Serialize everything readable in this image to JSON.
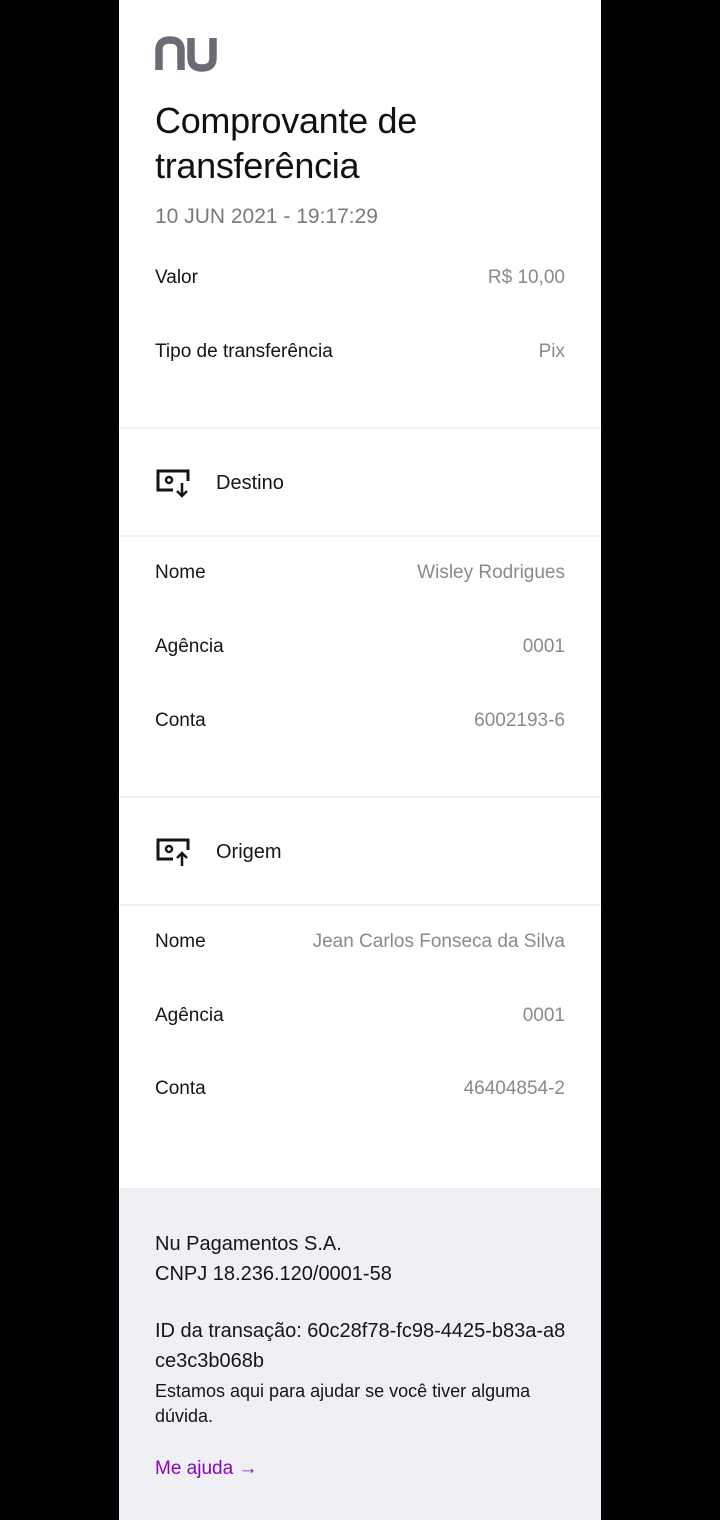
{
  "brand": {
    "logo_text": "nu"
  },
  "header": {
    "title": "Comprovante de transferência",
    "datetime": "10 JUN 2021 - 19:17:29"
  },
  "summary": {
    "value_label": "Valor",
    "value": "R$ 10,00",
    "type_label": "Tipo de transferência",
    "type": "Pix"
  },
  "destination": {
    "title": "Destino",
    "icon": "account-receive-icon",
    "name_label": "Nome",
    "name": "Wisley Rodrigues",
    "agency_label": "Agência",
    "agency": "0001",
    "account_label": "Conta",
    "account": "6002193-6"
  },
  "origin": {
    "title": "Origem",
    "icon": "account-send-icon",
    "name_label": "Nome",
    "name": "Jean Carlos Fonseca da Silva",
    "agency_label": "Agência",
    "agency": "0001",
    "account_label": "Conta",
    "account": "46404854-2"
  },
  "footer": {
    "company": "Nu Pagamentos S.A.",
    "cnpj": "CNPJ 18.236.120/0001-58",
    "transaction_id": "ID da transação: 60c28f78-fc98-4425-b83a-a8ce3c3b068b",
    "help_text": "Estamos aqui para ajudar se você tiver alguma dúvida.",
    "help_link": "Me ajuda",
    "help_link_arrow": "→"
  },
  "colors": {
    "background": "#000000",
    "card": "#ffffff",
    "footer_bg": "#eff0f4",
    "link": "#8a05be",
    "logo": "#6b6b78"
  }
}
